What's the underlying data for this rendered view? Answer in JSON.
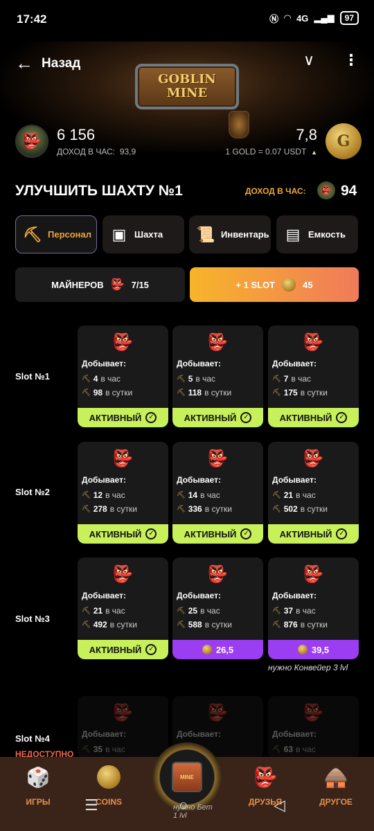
{
  "status_bar": {
    "time": "17:42",
    "network": "4G",
    "battery": "97"
  },
  "header": {
    "back_label": "Назад",
    "logo_line1": "GOBLIN",
    "logo_line2": "MINE"
  },
  "balance": {
    "amount": "6 156",
    "income_label": "ДОХОД В ЧАС:",
    "income_value": "93,9",
    "gold": "7,8",
    "rate": "1 GOLD = 0.07 USDT"
  },
  "section": {
    "title": "УЛУЧШИТЬ ШАХТУ №1",
    "income_label": "ДОХОД В ЧАС:",
    "income_value": "94"
  },
  "tabs": [
    {
      "label": "Персонал",
      "icon": "pickaxe-icon",
      "active": true
    },
    {
      "label": "Шахта",
      "icon": "mine-cart-icon",
      "active": false
    },
    {
      "label": "Инвентарь",
      "icon": "scroll-icon",
      "active": false
    },
    {
      "label": "Емкость",
      "icon": "safe-icon",
      "active": false
    }
  ],
  "miners": {
    "label": "МАЙНЕРОВ",
    "count": "7/15",
    "slot_label": "+ 1 SLOT",
    "slot_price": "45"
  },
  "slots": [
    {
      "label": "Slot №1",
      "cards": [
        {
          "mines": "Добывает:",
          "hour": "4",
          "day": "98",
          "hour_unit": "в час",
          "day_unit": "в сутки",
          "status": "АКТИВНЫЙ"
        },
        {
          "mines": "Добывает:",
          "hour": "5",
          "day": "118",
          "hour_unit": "в час",
          "day_unit": "в сутки",
          "status": "АКТИВНЫЙ"
        },
        {
          "mines": "Добывает:",
          "hour": "7",
          "day": "175",
          "hour_unit": "в час",
          "day_unit": "в сутки",
          "status": "АКТИВНЫЙ"
        }
      ]
    },
    {
      "label": "Slot №2",
      "cards": [
        {
          "mines": "Добывает:",
          "hour": "12",
          "day": "278",
          "hour_unit": "в час",
          "day_unit": "в сутки",
          "status": "АКТИВНЫЙ"
        },
        {
          "mines": "Добывает:",
          "hour": "14",
          "day": "336",
          "hour_unit": "в час",
          "day_unit": "в сутки",
          "status": "АКТИВНЫЙ"
        },
        {
          "mines": "Добывает:",
          "hour": "21",
          "day": "502",
          "hour_unit": "в час",
          "day_unit": "в сутки",
          "status": "АКТИВНЫЙ"
        }
      ]
    },
    {
      "label": "Slot №3",
      "cards": [
        {
          "mines": "Добывает:",
          "hour": "21",
          "day": "492",
          "hour_unit": "в час",
          "day_unit": "в сутки",
          "status": "АКТИВНЫЙ"
        },
        {
          "mines": "Добывает:",
          "hour": "25",
          "day": "588",
          "hour_unit": "в час",
          "day_unit": "в сутки",
          "price": "26,5"
        },
        {
          "mines": "Добывает:",
          "hour": "37",
          "day": "876",
          "hour_unit": "в час",
          "day_unit": "в сутки",
          "price": "39,5",
          "requirement": "нужно Конвейер 3 lvl"
        }
      ]
    },
    {
      "label": "Slot №4",
      "status": "НЕДОСТУПНО",
      "cards": [
        {
          "mines": "Добывает:",
          "hour": "35",
          "hour_unit": "в час"
        },
        {
          "mines": "Добывает:",
          "hour": "",
          "hour_unit": ""
        },
        {
          "mines": "Добывает:",
          "hour": "63",
          "hour_unit": "в час"
        }
      ]
    }
  ],
  "overlay_text": {
    "partial": "нужно Бет",
    "partial2": "1 lvl"
  },
  "bottom_nav": [
    {
      "label": "ИГРЫ",
      "icon": "dice-icon"
    },
    {
      "label": "COINS",
      "icon": "coin-icon"
    },
    {
      "label": "ДРУЗЬЯ",
      "icon": "goblins-icon"
    },
    {
      "label": "ДРУГОЕ",
      "icon": "house-icon"
    }
  ],
  "center_button": {
    "label": "MINE"
  }
}
